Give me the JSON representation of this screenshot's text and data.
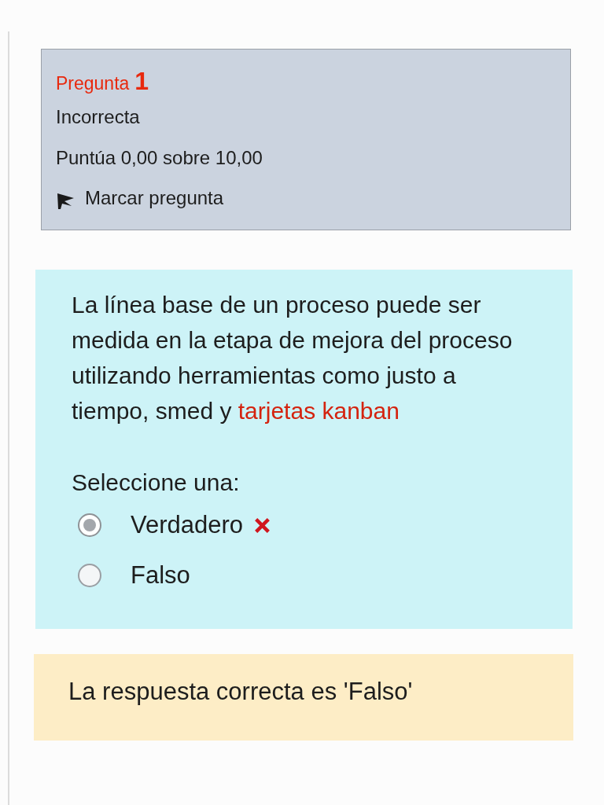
{
  "info": {
    "label": "Pregunta",
    "number": "1",
    "status": "Incorrecta",
    "grade": "Puntúa 0,00 sobre 10,00",
    "flag_label": "Marcar pregunta"
  },
  "question": {
    "text_parts": [
      {
        "text": "La línea base de un proceso puede ser medida en la etapa de mejora del proceso utilizando herramientas como justo a tiempo, smed y ",
        "highlight": false
      },
      {
        "text": "tarjetas kanban",
        "highlight": true
      }
    ],
    "prompt": "Seleccione una:",
    "options": [
      {
        "label": "Verdadero",
        "selected": true,
        "wrong": true
      },
      {
        "label": "Falso",
        "selected": false,
        "wrong": false
      }
    ]
  },
  "feedback": {
    "text": "La respuesta correcta es 'Falso'"
  }
}
